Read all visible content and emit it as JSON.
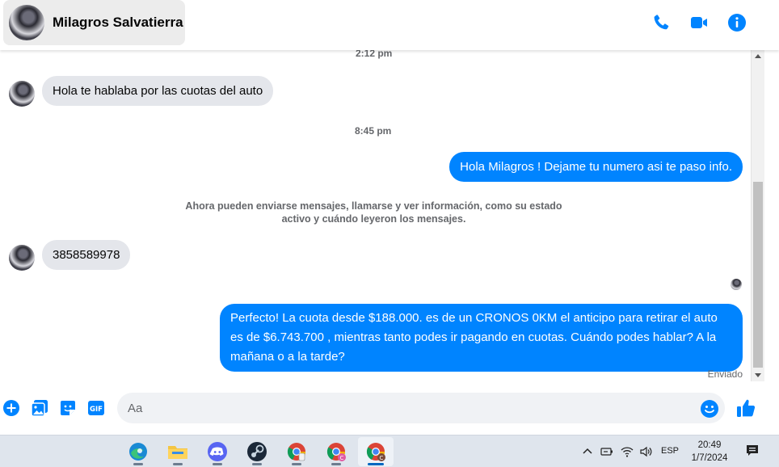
{
  "header": {
    "contact_name": "Milagros Salvatierra",
    "icons": [
      "phone-icon",
      "video-call-icon",
      "info-icon"
    ],
    "accent_color": "#0084ff"
  },
  "messages": {
    "timestamp_1": "2:12 pm",
    "incoming_1": "Hola te hablaba por las cuotas del auto",
    "timestamp_2": "8:45 pm",
    "outgoing_1": "Hola Milagros ! Dejame tu numero  asi te paso info.",
    "system_note": "Ahora pueden enviarse mensajes, llamarse y ver información, como su estado activo y cuándo leyeron los mensajes.",
    "incoming_2": "3858589978",
    "outgoing_2": "Perfecto! La cuota desde $188.000. es de un CRONOS 0KM el anticipo para retirar el auto es de $6.743.700 , mientras tanto podes ir pagando en cuotas. Cuándo podes hablar? A la mañana o a la tarde?",
    "status": "Enviado"
  },
  "composer": {
    "placeholder": "Aa",
    "icons": [
      "add-icon",
      "photo-icon",
      "sticker-icon",
      "gif-icon",
      "emoji-icon",
      "like-icon"
    ]
  },
  "taskbar": {
    "apps": [
      "edge-icon",
      "file-explorer-icon",
      "discord-icon",
      "steam-icon",
      "chrome-icon",
      "chrome-profile-icon",
      "chrome-profile-active-icon"
    ],
    "language": "ESP",
    "time": "20:49",
    "date": "1/7/2024"
  }
}
